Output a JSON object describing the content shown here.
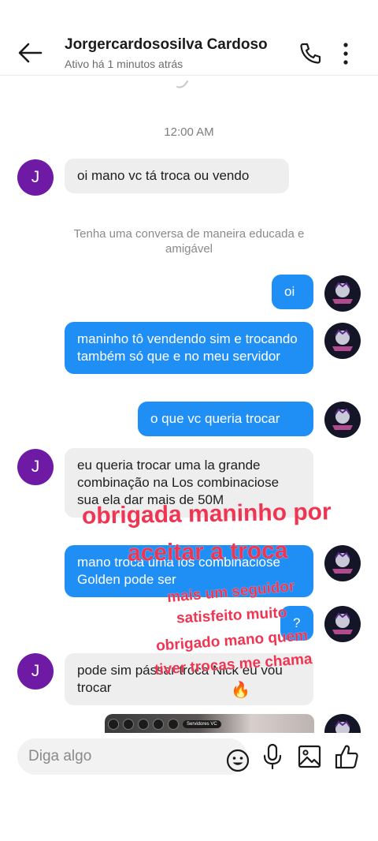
{
  "header": {
    "title": "Jorgercardososilva Cardoso",
    "status": "Ativo há 1 minutos atrás"
  },
  "chat": {
    "timestamp": "12:00 AM",
    "notice": "Tenha uma conversa de maneira educada e amigável",
    "contact_initial": "J",
    "messages": [
      {
        "side": "in",
        "text": "oi mano vc tá troca ou vendo"
      },
      {
        "side": "out",
        "text": "oi"
      },
      {
        "side": "out",
        "text": "maninho tô vendendo sim e trocando também só que e no meu servidor"
      },
      {
        "side": "out",
        "text": "o que vc queria trocar"
      },
      {
        "side": "in",
        "text": "eu queria trocar uma la grande combinação na Los combinaciose sua ela dar mais de 50M"
      },
      {
        "side": "out",
        "text": "mano troca uma los combinaciose Golden pode ser"
      },
      {
        "side": "out",
        "text": "?"
      },
      {
        "side": "in",
        "text": "pode sim pássar troca Nick eu vou trocar"
      }
    ],
    "media_label": "Servidores VC"
  },
  "overlay": {
    "line1": "obrigada maninho por",
    "line2": "aceitar a troca",
    "line3": "mais um seguidor",
    "line4": "satisfeito muito",
    "line5": "obrigado mano quem",
    "line6": "tiver trocas me chama",
    "emoji": "🔥"
  },
  "composer": {
    "placeholder": "Diga algo"
  },
  "colors": {
    "outgoing_bubble": "#1f8ff5",
    "incoming_bubble": "#eeeeee",
    "avatar": "#6f1aa5",
    "overlay_text": "#f03552"
  },
  "icons": [
    "back-arrow-icon",
    "phone-icon",
    "more-vertical-icon",
    "emoji-icon",
    "microphone-icon",
    "image-icon",
    "thumbs-up-icon"
  ]
}
